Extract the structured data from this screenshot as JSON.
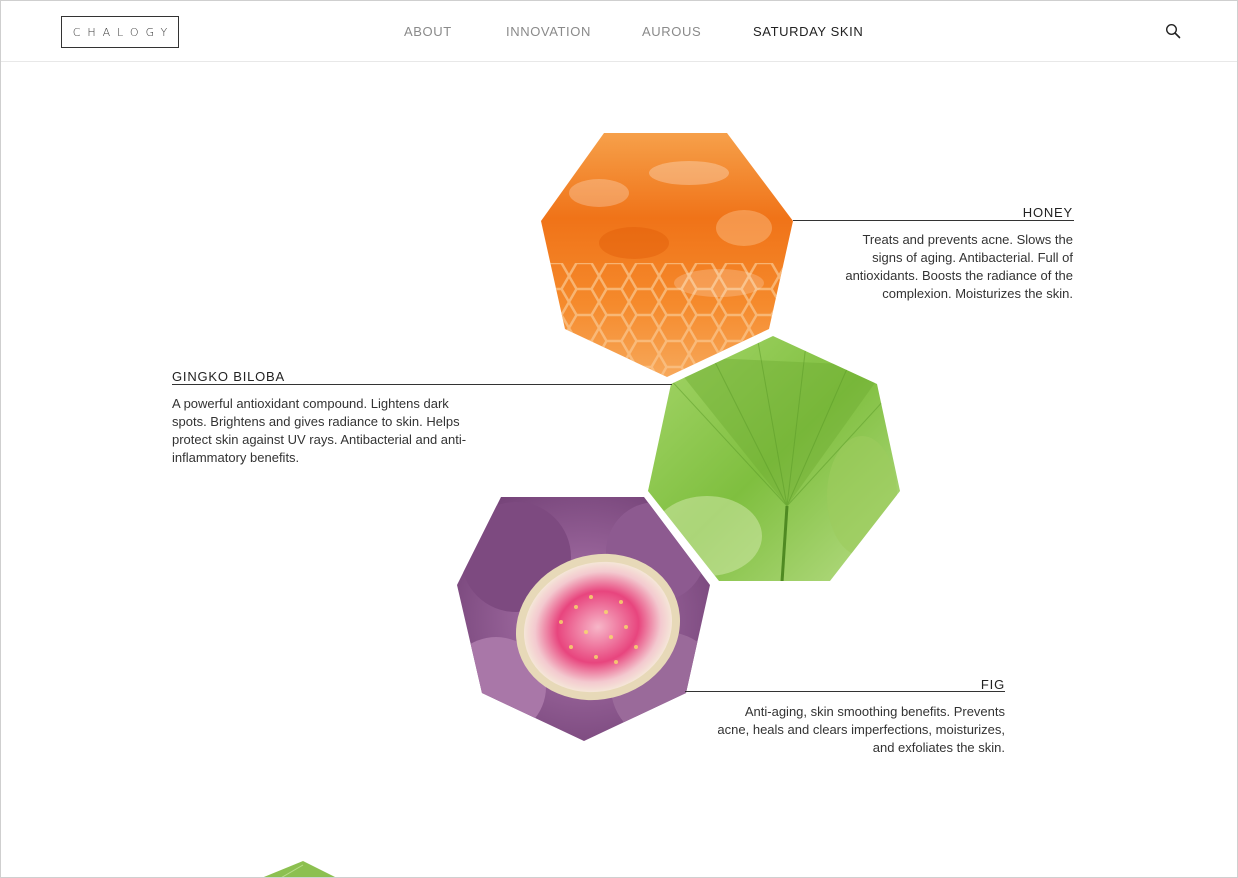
{
  "header": {
    "logo_text": "CHALOGY",
    "nav": [
      {
        "label": "ABOUT",
        "active": false
      },
      {
        "label": "INNOVATION",
        "active": false
      },
      {
        "label": "AUROUS",
        "active": false
      },
      {
        "label": "SATURDAY SKIN",
        "active": true
      }
    ],
    "search_icon": "search-icon"
  },
  "ingredients": [
    {
      "name": "HONEY",
      "description": "Treats and prevents acne. Slows the signs of aging. Antibacterial. Full of antioxidants. Boosts the radiance of the complexion. Moisturizes the skin."
    },
    {
      "name": "GINGKO BILOBA",
      "description": "A powerful antioxidant compound. Lightens dark spots. Brightens and gives radiance to skin. Helps protect skin against UV rays. Antibacterial and anti-inflammatory benefits."
    },
    {
      "name": "FIG",
      "description": "Anti-aging, skin smoothing benefits. Prevents acne, heals and clears imperfections, moisturizes, and exfoliates the skin."
    }
  ],
  "colors": {
    "honey": "#f27a1e",
    "gingko": "#8cc34a",
    "fig": "#8a4a8c",
    "fig_flesh": "#e8457e",
    "text": "#333333",
    "nav_inactive": "#8a8a8a"
  }
}
